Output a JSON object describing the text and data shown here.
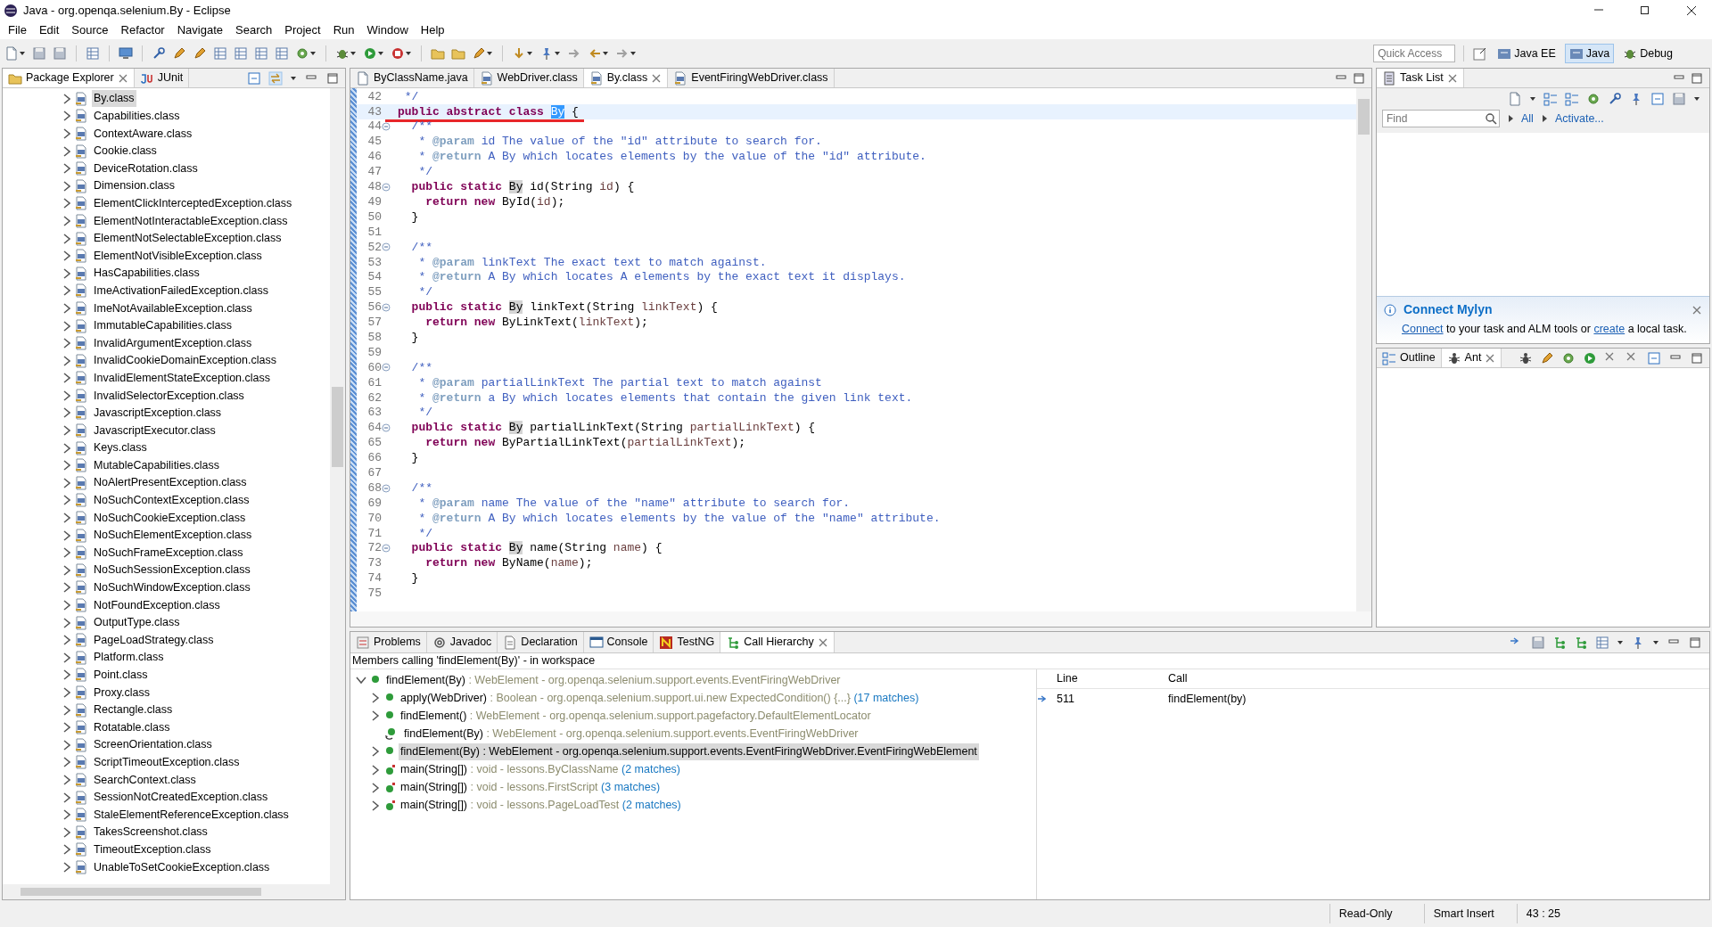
{
  "window": {
    "title": "Java - org.openqa.selenium.By - Eclipse"
  },
  "menu": [
    "File",
    "Edit",
    "Source",
    "Refactor",
    "Navigate",
    "Search",
    "Project",
    "Run",
    "Window",
    "Help"
  ],
  "quick_access": {
    "placeholder": "Quick Access"
  },
  "perspectives": [
    {
      "label": "Java EE",
      "selected": false
    },
    {
      "label": "Java",
      "selected": true
    },
    {
      "label": "Debug",
      "selected": false
    }
  ],
  "package_explorer": {
    "tabs": [
      {
        "label": "Package Explorer",
        "selected": true
      },
      {
        "label": "JUnit",
        "selected": false
      }
    ],
    "items": [
      {
        "label": "By.class",
        "selected": true
      },
      {
        "label": "Capabilities.class",
        "selected": false
      },
      {
        "label": "ContextAware.class",
        "selected": false
      },
      {
        "label": "Cookie.class",
        "selected": false
      },
      {
        "label": "DeviceRotation.class",
        "selected": false
      },
      {
        "label": "Dimension.class",
        "selected": false
      },
      {
        "label": "ElementClickInterceptedException.class",
        "selected": false
      },
      {
        "label": "ElementNotInteractableException.class",
        "selected": false
      },
      {
        "label": "ElementNotSelectableException.class",
        "selected": false
      },
      {
        "label": "ElementNotVisibleException.class",
        "selected": false
      },
      {
        "label": "HasCapabilities.class",
        "selected": false
      },
      {
        "label": "ImeActivationFailedException.class",
        "selected": false
      },
      {
        "label": "ImeNotAvailableException.class",
        "selected": false
      },
      {
        "label": "ImmutableCapabilities.class",
        "selected": false
      },
      {
        "label": "InvalidArgumentException.class",
        "selected": false
      },
      {
        "label": "InvalidCookieDomainException.class",
        "selected": false
      },
      {
        "label": "InvalidElementStateException.class",
        "selected": false
      },
      {
        "label": "InvalidSelectorException.class",
        "selected": false
      },
      {
        "label": "JavascriptException.class",
        "selected": false
      },
      {
        "label": "JavascriptExecutor.class",
        "selected": false
      },
      {
        "label": "Keys.class",
        "selected": false
      },
      {
        "label": "MutableCapabilities.class",
        "selected": false
      },
      {
        "label": "NoAlertPresentException.class",
        "selected": false
      },
      {
        "label": "NoSuchContextException.class",
        "selected": false
      },
      {
        "label": "NoSuchCookieException.class",
        "selected": false
      },
      {
        "label": "NoSuchElementException.class",
        "selected": false
      },
      {
        "label": "NoSuchFrameException.class",
        "selected": false
      },
      {
        "label": "NoSuchSessionException.class",
        "selected": false
      },
      {
        "label": "NoSuchWindowException.class",
        "selected": false
      },
      {
        "label": "NotFoundException.class",
        "selected": false
      },
      {
        "label": "OutputType.class",
        "selected": false
      },
      {
        "label": "PageLoadStrategy.class",
        "selected": false
      },
      {
        "label": "Platform.class",
        "selected": false
      },
      {
        "label": "Point.class",
        "selected": false
      },
      {
        "label": "Proxy.class",
        "selected": false
      },
      {
        "label": "Rectangle.class",
        "selected": false
      },
      {
        "label": "Rotatable.class",
        "selected": false
      },
      {
        "label": "ScreenOrientation.class",
        "selected": false
      },
      {
        "label": "ScriptTimeoutException.class",
        "selected": false
      },
      {
        "label": "SearchContext.class",
        "selected": false
      },
      {
        "label": "SessionNotCreatedException.class",
        "selected": false
      },
      {
        "label": "StaleElementReferenceException.class",
        "selected": false
      },
      {
        "label": "TakesScreenshot.class",
        "selected": false
      },
      {
        "label": "TimeoutException.class",
        "selected": false
      },
      {
        "label": "UnableToSetCookieException.class",
        "selected": false
      }
    ]
  },
  "editor": {
    "tabs": [
      {
        "label": "ByClassName.java",
        "selected": false
      },
      {
        "label": "WebDriver.class",
        "selected": false
      },
      {
        "label": "By.class",
        "selected": true
      },
      {
        "label": "EventFiringWebDriver.class",
        "selected": false
      }
    ],
    "lines": [
      {
        "number": "42",
        "fold": false,
        "current": false,
        "underlined": false,
        "tokens": [
          {
            "kind": "comment",
            "text": " */"
          }
        ]
      },
      {
        "number": "43",
        "fold": false,
        "current": true,
        "underlined": true,
        "tokens": [
          {
            "kind": "keyword",
            "text": "public abstract class "
          },
          {
            "kind": "selection",
            "text": "By"
          },
          {
            "kind": "plain",
            "text": " {"
          }
        ]
      },
      {
        "number": "44",
        "fold": true,
        "current": false,
        "underlined": false,
        "tokens": [
          {
            "kind": "comment",
            "text": "  /**"
          }
        ]
      },
      {
        "number": "45",
        "fold": false,
        "current": false,
        "underlined": false,
        "tokens": [
          {
            "kind": "comment",
            "text": "   * "
          },
          {
            "kind": "doctag",
            "text": "@param"
          },
          {
            "kind": "comment",
            "text": " id The value of the \"id\" attribute to search for."
          }
        ]
      },
      {
        "number": "46",
        "fold": false,
        "current": false,
        "underlined": false,
        "tokens": [
          {
            "kind": "comment",
            "text": "   * "
          },
          {
            "kind": "doctag",
            "text": "@return"
          },
          {
            "kind": "comment",
            "text": " A By which locates elements by the value of the \"id\" attribute."
          }
        ]
      },
      {
        "number": "47",
        "fold": false,
        "current": false,
        "underlined": false,
        "tokens": [
          {
            "kind": "comment",
            "text": "   */"
          }
        ]
      },
      {
        "number": "48",
        "fold": true,
        "current": false,
        "underlined": false,
        "tokens": [
          {
            "kind": "keyword",
            "text": "  public static "
          },
          {
            "kind": "occurrence",
            "text": "By"
          },
          {
            "kind": "plain",
            "text": " id(String "
          },
          {
            "kind": "param",
            "text": "id"
          },
          {
            "kind": "plain",
            "text": ") {"
          }
        ]
      },
      {
        "number": "49",
        "fold": false,
        "current": false,
        "underlined": false,
        "tokens": [
          {
            "kind": "keyword",
            "text": "    return new "
          },
          {
            "kind": "plain",
            "text": "ById("
          },
          {
            "kind": "param",
            "text": "id"
          },
          {
            "kind": "plain",
            "text": ");"
          }
        ]
      },
      {
        "number": "50",
        "fold": false,
        "current": false,
        "underlined": false,
        "tokens": [
          {
            "kind": "plain",
            "text": "  }"
          }
        ]
      },
      {
        "number": "51",
        "fold": false,
        "current": false,
        "underlined": false
      },
      {
        "number": "52",
        "fold": true,
        "current": false,
        "underlined": false,
        "tokens": [
          {
            "kind": "comment",
            "text": "  /**"
          }
        ]
      },
      {
        "number": "53",
        "fold": false,
        "current": false,
        "underlined": false,
        "tokens": [
          {
            "kind": "comment",
            "text": "   * "
          },
          {
            "kind": "doctag",
            "text": "@param"
          },
          {
            "kind": "comment",
            "text": " linkText The exact text to match against."
          }
        ]
      },
      {
        "number": "54",
        "fold": false,
        "current": false,
        "underlined": false,
        "tokens": [
          {
            "kind": "comment",
            "text": "   * "
          },
          {
            "kind": "doctag",
            "text": "@return"
          },
          {
            "kind": "comment",
            "text": " A By which locates A elements by the exact text it displays."
          }
        ]
      },
      {
        "number": "55",
        "fold": false,
        "current": false,
        "underlined": false,
        "tokens": [
          {
            "kind": "comment",
            "text": "   */"
          }
        ]
      },
      {
        "number": "56",
        "fold": true,
        "current": false,
        "underlined": false,
        "tokens": [
          {
            "kind": "keyword",
            "text": "  public static "
          },
          {
            "kind": "occurrence",
            "text": "By"
          },
          {
            "kind": "plain",
            "text": " linkText(String "
          },
          {
            "kind": "param",
            "text": "linkText"
          },
          {
            "kind": "plain",
            "text": ") {"
          }
        ]
      },
      {
        "number": "57",
        "fold": false,
        "current": false,
        "underlined": false,
        "tokens": [
          {
            "kind": "keyword",
            "text": "    return new "
          },
          {
            "kind": "plain",
            "text": "ByLinkText("
          },
          {
            "kind": "param",
            "text": "linkText"
          },
          {
            "kind": "plain",
            "text": ");"
          }
        ]
      },
      {
        "number": "58",
        "fold": false,
        "current": false,
        "underlined": false,
        "tokens": [
          {
            "kind": "plain",
            "text": "  }"
          }
        ]
      },
      {
        "number": "59",
        "fold": false,
        "current": false,
        "underlined": false
      },
      {
        "number": "60",
        "fold": true,
        "current": false,
        "underlined": false,
        "tokens": [
          {
            "kind": "comment",
            "text": "  /**"
          }
        ]
      },
      {
        "number": "61",
        "fold": false,
        "current": false,
        "underlined": false,
        "tokens": [
          {
            "kind": "comment",
            "text": "   * "
          },
          {
            "kind": "doctag",
            "text": "@param"
          },
          {
            "kind": "comment",
            "text": " partialLinkText The partial text to match against"
          }
        ]
      },
      {
        "number": "62",
        "fold": false,
        "current": false,
        "underlined": false,
        "tokens": [
          {
            "kind": "comment",
            "text": "   * "
          },
          {
            "kind": "doctag",
            "text": "@return"
          },
          {
            "kind": "comment",
            "text": " a By which locates elements that contain the given link text."
          }
        ]
      },
      {
        "number": "63",
        "fold": false,
        "current": false,
        "underlined": false,
        "tokens": [
          {
            "kind": "comment",
            "text": "   */"
          }
        ]
      },
      {
        "number": "64",
        "fold": true,
        "current": false,
        "underlined": false,
        "tokens": [
          {
            "kind": "keyword",
            "text": "  public static "
          },
          {
            "kind": "occurrence",
            "text": "By"
          },
          {
            "kind": "plain",
            "text": " partialLinkText(String "
          },
          {
            "kind": "param",
            "text": "partialLinkText"
          },
          {
            "kind": "plain",
            "text": ") {"
          }
        ]
      },
      {
        "number": "65",
        "fold": false,
        "current": false,
        "underlined": false,
        "tokens": [
          {
            "kind": "keyword",
            "text": "    return new "
          },
          {
            "kind": "plain",
            "text": "ByPartialLinkText("
          },
          {
            "kind": "param",
            "text": "partialLinkText"
          },
          {
            "kind": "plain",
            "text": ");"
          }
        ]
      },
      {
        "number": "66",
        "fold": false,
        "current": false,
        "underlined": false,
        "tokens": [
          {
            "kind": "plain",
            "text": "  }"
          }
        ]
      },
      {
        "number": "67",
        "fold": false,
        "current": false,
        "underlined": false
      },
      {
        "number": "68",
        "fold": true,
        "current": false,
        "underlined": false,
        "tokens": [
          {
            "kind": "comment",
            "text": "  /**"
          }
        ]
      },
      {
        "number": "69",
        "fold": false,
        "current": false,
        "underlined": false,
        "tokens": [
          {
            "kind": "comment",
            "text": "   * "
          },
          {
            "kind": "doctag",
            "text": "@param"
          },
          {
            "kind": "comment",
            "text": " name The value of the \"name\" attribute to search for."
          }
        ]
      },
      {
        "number": "70",
        "fold": false,
        "current": false,
        "underlined": false,
        "tokens": [
          {
            "kind": "comment",
            "text": "   * "
          },
          {
            "kind": "doctag",
            "text": "@return"
          },
          {
            "kind": "comment",
            "text": " A By which locates elements by the value of the \"name\" attribute."
          }
        ]
      },
      {
        "number": "71",
        "fold": false,
        "current": false,
        "underlined": false,
        "tokens": [
          {
            "kind": "comment",
            "text": "   */"
          }
        ]
      },
      {
        "number": "72",
        "fold": true,
        "current": false,
        "underlined": false,
        "tokens": [
          {
            "kind": "keyword",
            "text": "  public static "
          },
          {
            "kind": "occurrence",
            "text": "By"
          },
          {
            "kind": "plain",
            "text": " name(String "
          },
          {
            "kind": "param",
            "text": "name"
          },
          {
            "kind": "plain",
            "text": ") {"
          }
        ]
      },
      {
        "number": "73",
        "fold": false,
        "current": false,
        "underlined": false,
        "tokens": [
          {
            "kind": "keyword",
            "text": "    return new "
          },
          {
            "kind": "plain",
            "text": "ByName("
          },
          {
            "kind": "param",
            "text": "name"
          },
          {
            "kind": "plain",
            "text": ");"
          }
        ]
      },
      {
        "number": "74",
        "fold": false,
        "current": false,
        "underlined": false,
        "tokens": [
          {
            "kind": "plain",
            "text": "  }"
          }
        ]
      },
      {
        "number": "75",
        "fold": false,
        "current": false,
        "underlined": false
      }
    ]
  },
  "task_list": {
    "tab": "Task List",
    "find": {
      "placeholder": "Find"
    },
    "links": [
      "All",
      "Activate..."
    ],
    "mylyn": {
      "title": "Connect Mylyn",
      "link_connect": "Connect",
      "text_middle": " to your task and ALM tools or ",
      "link_create": "create",
      "text_end": " a local task."
    }
  },
  "outline": {
    "tabs": [
      {
        "label": "Outline",
        "selected": false
      },
      {
        "label": "Ant",
        "selected": true
      }
    ]
  },
  "bottom": {
    "tabs": [
      {
        "label": "Problems",
        "selected": false
      },
      {
        "label": "Javadoc",
        "selected": false
      },
      {
        "label": "Declaration",
        "selected": false
      },
      {
        "label": "Console",
        "selected": false
      },
      {
        "label": "TestNG",
        "selected": false
      },
      {
        "label": "Call Hierarchy",
        "selected": true
      }
    ],
    "header": "Members calling 'findElement(By)' - in workspace",
    "tree": {
      "kind": "method",
      "name": "findElement(By)",
      "detail": " : WebElement - org.openqa.selenium.support.events.EventFiringWebDriver",
      "expanded": true,
      "selected": false,
      "children": [
        {
          "kind": "method",
          "name": "apply(WebDriver)",
          "detail": " : Boolean - org.openqa.selenium.support.ui.new ExpectedCondition() {...}",
          "matches": " (17 matches)",
          "selected": false
        },
        {
          "kind": "method",
          "name": "findElement()",
          "detail": " : WebElement - org.openqa.selenium.support.pagefactory.DefaultElementLocator",
          "selected": false
        },
        {
          "kind": "recursive",
          "name": "findElement(By)",
          "detail": " : WebElement - org.openqa.selenium.support.events.EventFiringWebDriver",
          "selected": false
        },
        {
          "kind": "method",
          "name": "findElement(By)",
          "detail": " : WebElement - org.openqa.selenium.support.events.EventFiringWebDriver.EventFiringWebElement",
          "selected": true
        },
        {
          "kind": "static",
          "name": "main(String[])",
          "detail": " : void - lessons.ByClassName",
          "matches": " (2 matches)",
          "selected": false
        },
        {
          "kind": "static",
          "name": "main(String[])",
          "detail": " : void - lessons.FirstScript",
          "matches": " (3 matches)",
          "selected": false
        },
        {
          "kind": "static",
          "name": "main(String[])",
          "detail": " : void - lessons.PageLoadTest",
          "matches": " (2 matches)",
          "selected": false
        }
      ]
    },
    "table": {
      "columns": [
        "Line",
        "Call"
      ],
      "rows": [
        {
          "line": "511",
          "call": "findElement(by)"
        }
      ]
    }
  },
  "status_bar": [
    "Read-Only",
    "Smart Insert",
    "43 : 25"
  ]
}
